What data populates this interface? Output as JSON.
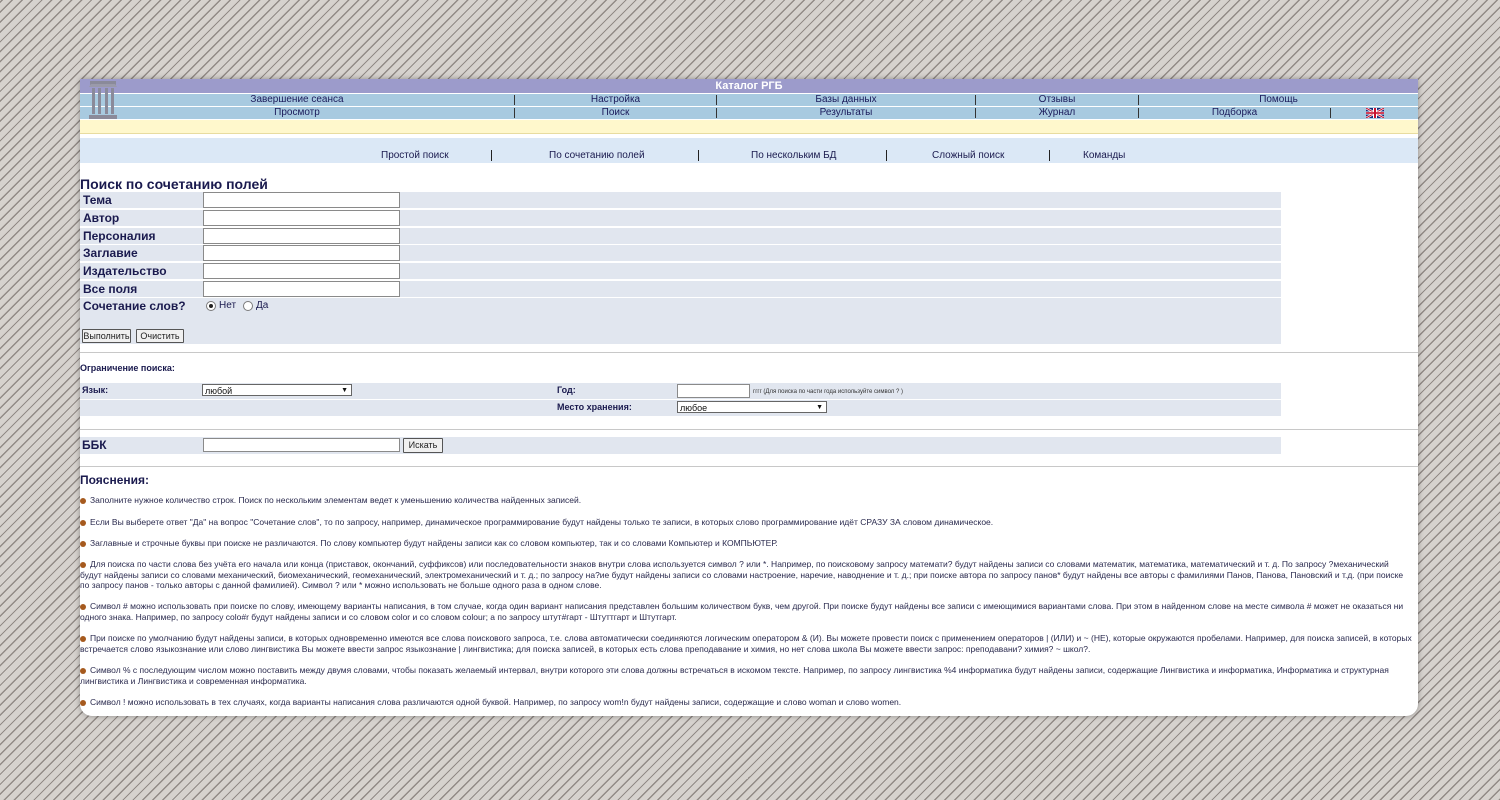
{
  "app_title": "Каталог РГБ",
  "nav_row1": [
    "Завершение сеанса",
    "Настройка",
    "Базы данных",
    "Отзывы",
    "Помощь"
  ],
  "nav_row2": [
    "Просмотр",
    "Поиск",
    "Результаты",
    "Журнал",
    "Подборка"
  ],
  "subnav": [
    "Простой поиск",
    "По сочетанию полей",
    "По нескольким БД",
    "Сложный поиск",
    "Команды"
  ],
  "page_title": "Поиск по сочетанию полей",
  "fields": [
    "Тема",
    "Автор",
    "Персоналия",
    "Заглавие",
    "Издательство",
    "Все поля"
  ],
  "combine_label": "Сочетание слов?",
  "combine_options": [
    "Нет",
    "Да"
  ],
  "combine_selected": "Нет",
  "buttons": {
    "run": "Выполнить",
    "clear": "Очистить",
    "search": "Искать"
  },
  "restrict": {
    "title": "Ограничение поиска:",
    "lang_label": "Язык:",
    "lang_value": "любой",
    "year_label": "Год:",
    "year_hint": "гггг (Для поиска по части года используйте символ ? )",
    "place_label": "Место хранения:",
    "place_value": "любое"
  },
  "bbk_label": "ББК",
  "expl_title": "Пояснения:",
  "notes": [
    "Заполните нужное количество строк. Поиск по нескольким элементам ведет к уменьшению количества найденных записей.",
    "Если Вы выберете ответ \"Да\" на вопрос \"Сочетание слов\", то по запросу, например, динамическое программирование будут найдены только те записи, в которых слово программирование идёт СРАЗУ ЗА словом динамическое.",
    "Заглавные и строчные буквы при поиске не различаются. По слову компьютер будут найдены записи как со словом компьютер, так и со словами Компьютер и КОМПЬЮТЕР.",
    "Для поиска по части слова без учёта его начала или конца (приставок, окончаний, суффиксов) или последовательности знаков внутри слова используется символ ? или *. Например, по поисковому запросу математи? будут найдены записи со словами математик, математика, математический и т. д. По запросу ?механический будут найдены записи со словами механический, биомеханический, геомеханический, электромеханический и т. д.; по запросу на?ие будут найдены записи со словами настроение, наречие, наводнение и т. д.; при поиске автора по запросу панов* будут найдены все авторы с фамилиями Панов, Панова, Пановский и т.д. (при поиске по запросу панов - только авторы с данной фамилией). Символ ? или * можно использовать не больше одного раза в одном слове.",
    "Символ # можно использовать при поиске по слову, имеющему варианты написания, в том случае, когда один вариант написания представлен большим количеством букв, чем другой. При поиске будут найдены все записи с имеющимися вариантами слова. При этом в найденном слове на месте символа # может не оказаться ни одного знака. Например, по запросу colo#r будут найдены записи и со словом color и со словом colour; а по запросу штут#гарт - Штуттгарт и Штутгарт.",
    "При поиске по умолчанию будут найдены записи, в которых одновременно имеются все слова поискового запроса, т.е. слова автоматически соединяются логическим оператором & (И). Вы можете провести поиск с применением операторов | (ИЛИ) и ~ (НЕ), которые окружаются пробелами. Например, для поиска записей, в которых встречается слово языкознание или слово лингвистика Вы можете ввести запрос языкознание | лингвистика; для поиска записей, в которых есть слова преподавание и химия, но нет слова школа Вы можете ввести запрос: преподавани? химия? ~ школ?.",
    "Символ % с последующим числом можно поставить между двумя словами, чтобы показать желаемый интервал, внутри которого эти слова должны встречаться в искомом тексте. Например, по запросу лингвистика %4 информатика будут найдены записи, содержащие Лингвистика и информатика, Информатика и структурная лингвистика и Лингвистика и современная информатика.",
    "Символ ! можно использовать в тех случаях, когда варианты написания слова различаются одной буквой. Например, по запросу wom!n будут найдены записи, содержащие и слово woman и слово women."
  ],
  "colors": {
    "title_bar": "#9c9bcb",
    "nav_bg": "#a8cae0",
    "yellow_bar": "#fff8cc",
    "subnav_bg": "#dbe8f6",
    "row_bg": "#e1e6ef"
  }
}
